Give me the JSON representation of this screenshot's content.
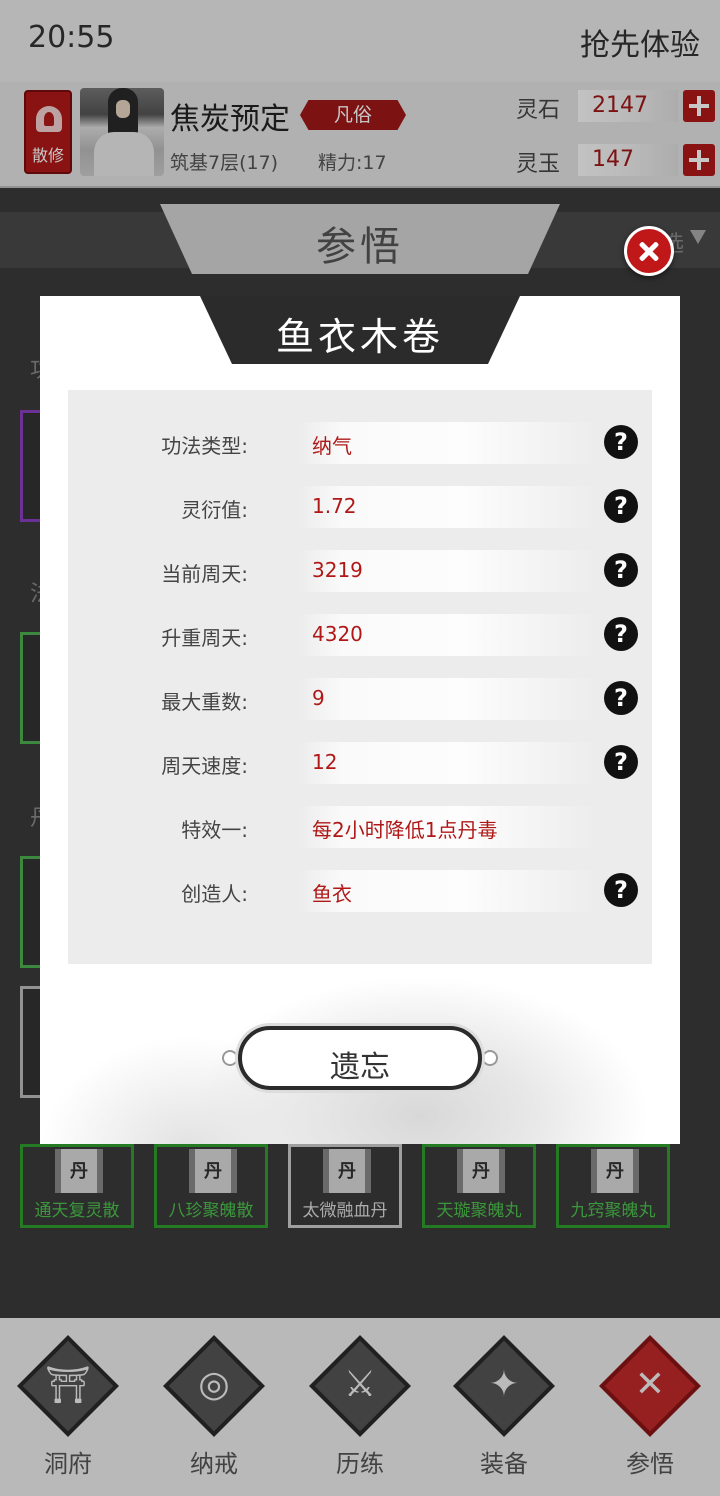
{
  "status_bar": {
    "time": "20:55",
    "experience_label": "抢先体验"
  },
  "player": {
    "badge_label": "散修",
    "name": "焦炭预定",
    "rank": "凡俗",
    "realm": "筑基7层(17)",
    "energy": "精力:17"
  },
  "resources": [
    {
      "label": "灵石",
      "value": "2147"
    },
    {
      "label": "灵玉",
      "value": "147"
    }
  ],
  "panel": {
    "title": "参悟",
    "filter_label": "选"
  },
  "background_sections": [
    "功",
    "法",
    "丹"
  ],
  "items": [
    {
      "icon_char": "丹",
      "name": "通天复灵散",
      "rarity_color": "#2f9e2f"
    },
    {
      "icon_char": "丹",
      "name": "八珍聚魄散",
      "rarity_color": "#2f9e2f"
    },
    {
      "icon_char": "丹",
      "name": "太微融血丹",
      "rarity_color": "#cccccc"
    },
    {
      "icon_char": "丹",
      "name": "天璇聚魄丸",
      "rarity_color": "#2f9e2f"
    },
    {
      "icon_char": "丹",
      "name": "九窍聚魄丸",
      "rarity_color": "#2f9e2f"
    }
  ],
  "dialog": {
    "title": "鱼衣木卷",
    "stats": [
      {
        "label": "功法类型:",
        "value": "纳气"
      },
      {
        "label": "灵衍值:",
        "value": "1.72"
      },
      {
        "label": "当前周天:",
        "value": "3219"
      },
      {
        "label": "升重周天:",
        "value": "4320"
      },
      {
        "label": "最大重数:",
        "value": "9"
      },
      {
        "label": "周天速度:",
        "value": "12"
      },
      {
        "label": "特效一:",
        "value": "每2小时降低1点丹毒"
      },
      {
        "label": "创造人:",
        "value": "鱼衣"
      }
    ],
    "help_glyph": "?",
    "forget_button": "遗忘"
  },
  "bottom_nav": [
    {
      "label": "洞府",
      "icon": "cave-icon",
      "glyph": "⛩"
    },
    {
      "label": "纳戒",
      "icon": "ring-icon",
      "glyph": "◎"
    },
    {
      "label": "历练",
      "icon": "crossed-swords-icon",
      "glyph": "⚔"
    },
    {
      "label": "装备",
      "icon": "dagger-icon",
      "glyph": "✦"
    },
    {
      "label": "参悟",
      "icon": "close-x-icon",
      "glyph": "✕",
      "active": true
    }
  ],
  "colors": {
    "accent_red": "#b01818",
    "rare_green": "#2f9e2f"
  }
}
